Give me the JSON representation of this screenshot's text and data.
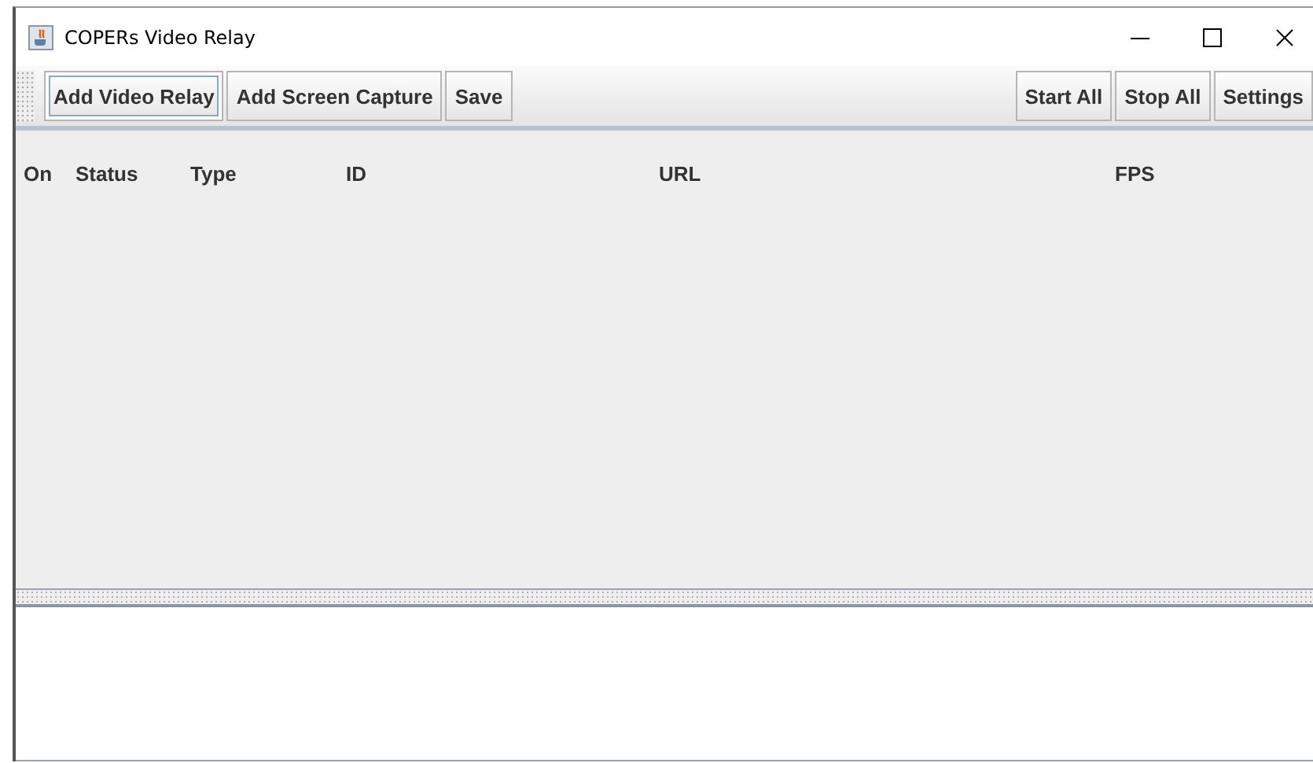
{
  "window": {
    "title": "COPERs Video Relay"
  },
  "toolbar": {
    "left_buttons": [
      {
        "label": "Add Video Relay",
        "focused": true
      },
      {
        "label": "Add Screen Capture",
        "focused": false
      },
      {
        "label": "Save",
        "focused": false
      }
    ],
    "right_buttons": [
      {
        "label": "Start All",
        "focused": false
      },
      {
        "label": "Stop All",
        "focused": false
      },
      {
        "label": "Settings",
        "focused": false
      }
    ]
  },
  "table": {
    "columns": [
      "On",
      "Status",
      "Type",
      "ID",
      "URL",
      "FPS"
    ]
  }
}
